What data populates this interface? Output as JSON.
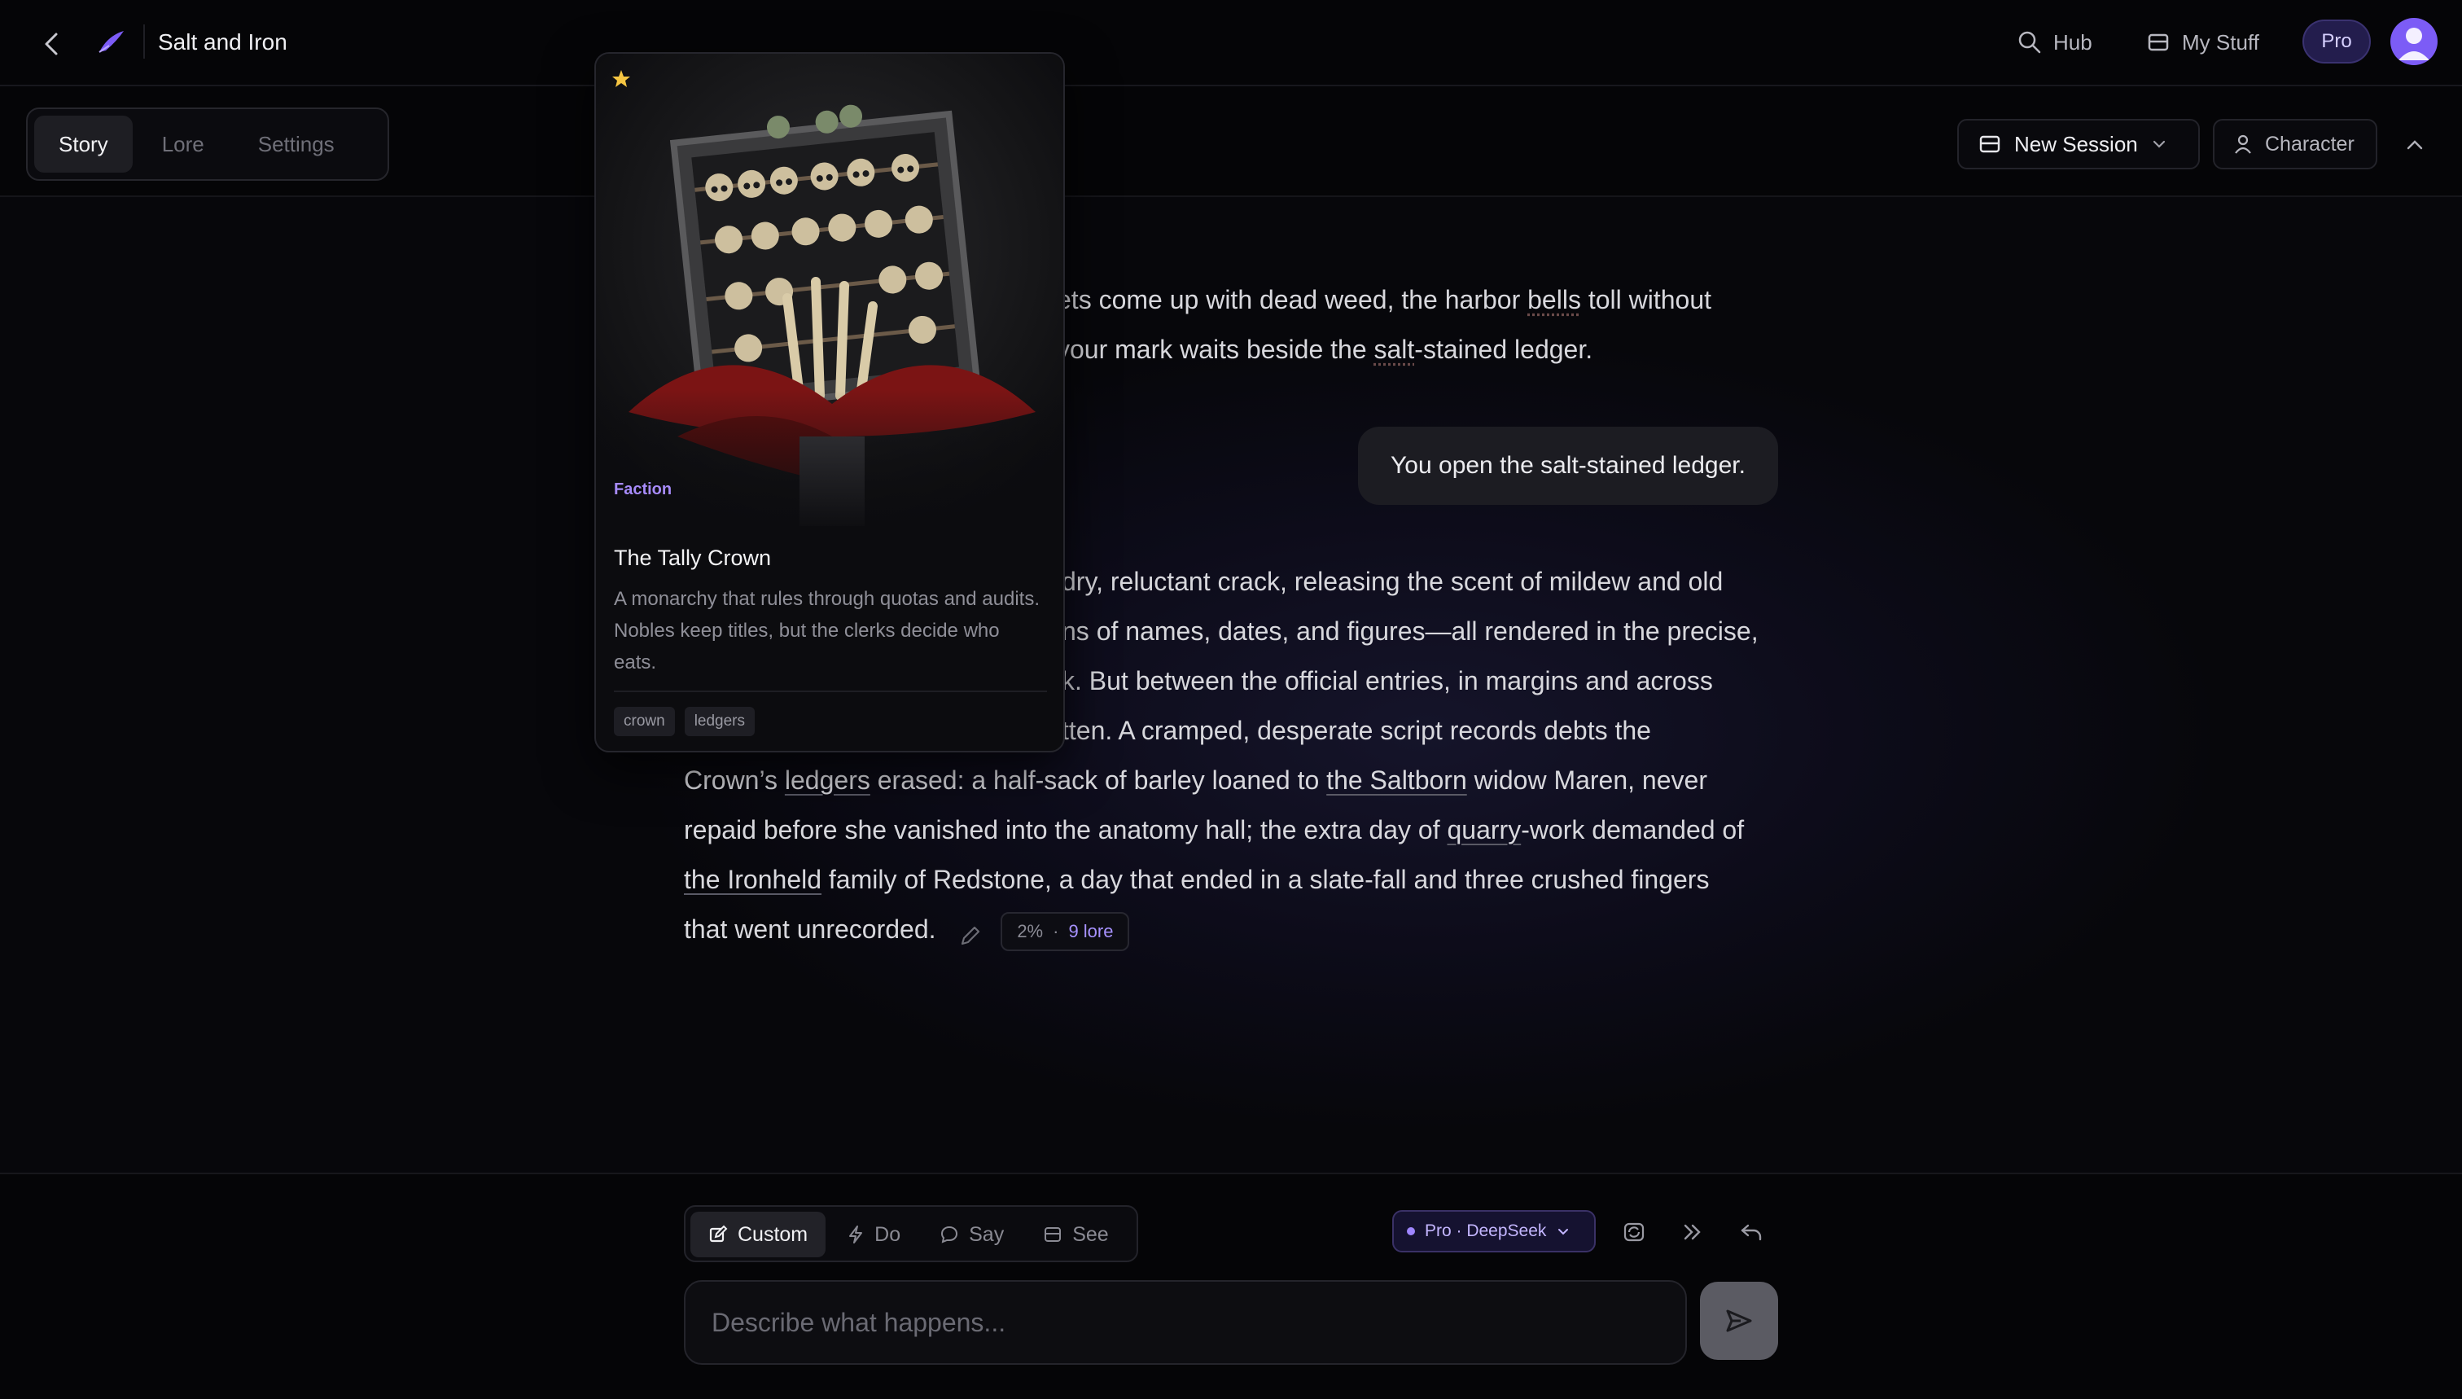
{
  "header": {
    "title": "Salt and Iron",
    "hub_label": "Hub",
    "my_stuff_label": "My Stuff",
    "pro_label": "Pro"
  },
  "tabs": [
    {
      "label": "Story"
    },
    {
      "label": "Lore"
    },
    {
      "label": "Settings"
    }
  ],
  "toolbar": {
    "session_label": "New Session",
    "character_label": "Character"
  },
  "story": {
    "p1_a": "ets come up with dead weed, the harbor ",
    "p1_link1": "bells",
    "p1_b": " toll without",
    "p1_c": "your mark waits beside the ",
    "p1_link2": "salt",
    "p1_d": "-stained ledger.",
    "user_action": "You open the salt-stained ledger.",
    "p2_l1": "dry, reluctant crack, releasing the scent of mildew and old",
    "p2_l2": "ns of names, dates, and figures—all rendered in the precise,",
    "p2_l3": "k. But between the official entries, in margins and across",
    "p2_l4": "tten. A cramped, desperate script records debts the",
    "p2_l5a": "Crown’s ",
    "p2_l5_link": "ledgers",
    "p2_l5b": " erased: a half-sack of barley loaned to ",
    "p2_l5_link2": "the Saltborn",
    "p2_l5c": " widow Maren, never",
    "p2_l6a": "repaid before she vanished into the anatomy hall; the extra day of ",
    "p2_l6_link": "quarry",
    "p2_l6b": "-work demanded of",
    "p2_l7_link": "the Ironheld",
    "p2_l7b": " family of Redstone, a day that ended in a slate-fall and three crushed fingers",
    "p2_l8": "that went unrecorded.",
    "meta_percent": "2%",
    "meta_sep": "·",
    "meta_lore": "9 lore"
  },
  "lore_card": {
    "type": "Faction",
    "name": "The Tally Crown",
    "description": "A monarchy that rules through quotas and audits. Nobles keep titles, but the clerks decide who eats.",
    "tags": [
      "crown",
      "ledgers"
    ]
  },
  "composer": {
    "modes": [
      {
        "label": "Custom",
        "icon": "edit-icon"
      },
      {
        "label": "Do",
        "icon": "lightning-icon"
      },
      {
        "label": "Say",
        "icon": "speech-bubble-icon"
      },
      {
        "label": "See",
        "icon": "image-icon"
      }
    ],
    "model_label": "Pro · DeepSeek",
    "placeholder": "Describe what happens..."
  },
  "colors": {
    "accent": "#7c5cf6",
    "accent_text": "#a78bfa",
    "background": "#07070b"
  }
}
